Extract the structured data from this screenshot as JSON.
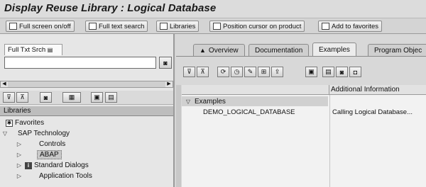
{
  "window": {
    "title": "Display Reuse Library : Logical Database"
  },
  "toolbar": {
    "buttons": [
      {
        "label": "Full screen on/off",
        "icon": "fullscreen-icon"
      },
      {
        "label": "Full text search",
        "icon": "search-icon"
      },
      {
        "label": "Libraries",
        "icon": "books-icon"
      },
      {
        "label": "Position cursor on product",
        "icon": "cursor-icon"
      },
      {
        "label": "Add to favorites",
        "icon": "favorites-icon"
      }
    ]
  },
  "left_pane": {
    "tab_label": "Full Txt Srch",
    "search": {
      "value": "",
      "placeholder": ""
    },
    "libraries_header": "Libraries",
    "tree": [
      {
        "label": "Favorites",
        "icon": "star-icon",
        "expander": ""
      },
      {
        "label": "SAP Technology",
        "icon": "",
        "expander": "expanded"
      },
      {
        "label": "Controls",
        "icon": "",
        "expander": "collapsed"
      },
      {
        "label": "ABAP",
        "icon": "",
        "expander": "collapsed",
        "selected": true
      },
      {
        "label": "Standard Dialogs",
        "icon": "info-icon",
        "expander": "collapsed"
      },
      {
        "label": "Application Tools",
        "icon": "",
        "expander": "collapsed"
      }
    ]
  },
  "right_pane": {
    "tabs": [
      {
        "label": "Overview",
        "icon": "overview-icon",
        "active": false
      },
      {
        "label": "Documentation",
        "active": false
      },
      {
        "label": "Examples",
        "active": true
      },
      {
        "label": "Program Objec",
        "active": false
      }
    ],
    "grid": {
      "columns": [
        "",
        "Additional Information"
      ],
      "group_label": "Examples",
      "rows": [
        {
          "name": "DEMO_LOGICAL_DATABASE",
          "info": "Calling Logical Database..."
        }
      ]
    }
  },
  "colors": {
    "background": "#d6d6d6",
    "pane": "#e6e6e6",
    "grid_body": "#f2f2f2"
  }
}
